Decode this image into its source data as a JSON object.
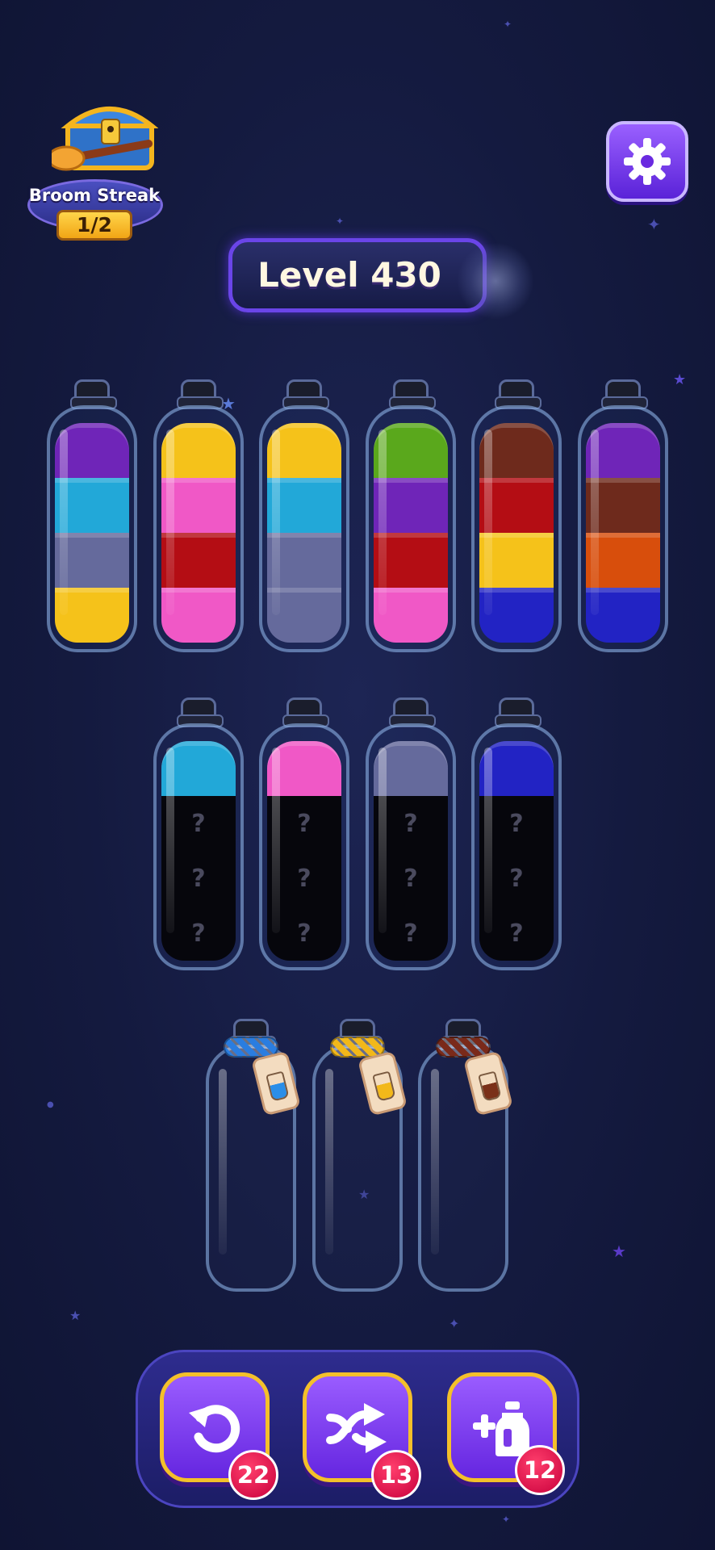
{
  "streak": {
    "title": "Broom Streak",
    "count": "1/2"
  },
  "level": {
    "label": "Level 430"
  },
  "colors": {
    "purple": "#6f25b8",
    "cyan": "#22a8d8",
    "slate": "#656a9c",
    "yellow": "#f5c21a",
    "pink": "#f058c6",
    "red": "#b40d14",
    "green": "#5aa81c",
    "brown": "#6e2a1c",
    "blue": "#2223c4",
    "orange": "#d84e0c",
    "hidden": "#06060c",
    "accent": "#6a45e8",
    "badge": "#d6104a"
  },
  "bottles": {
    "row1": [
      {
        "layers": [
          "yellow",
          "slate",
          "cyan",
          "purple"
        ]
      },
      {
        "layers": [
          "pink",
          "red",
          "pink",
          "yellow"
        ]
      },
      {
        "layers": [
          "slate",
          "slate",
          "cyan",
          "yellow"
        ]
      },
      {
        "layers": [
          "pink",
          "red",
          "purple",
          "green"
        ]
      },
      {
        "layers": [
          "blue",
          "yellow",
          "red",
          "brown"
        ]
      },
      {
        "layers": [
          "blue",
          "orange",
          "brown",
          "purple"
        ]
      }
    ],
    "row2": [
      {
        "top": "cyan",
        "unknown": [
          "?",
          "?",
          "?"
        ]
      },
      {
        "top": "pink",
        "unknown": [
          "?",
          "?",
          "?"
        ]
      },
      {
        "top": "slate",
        "unknown": [
          "?",
          "?",
          "?"
        ]
      },
      {
        "top": "blue",
        "unknown": [
          "?",
          "?",
          "?"
        ]
      }
    ],
    "locked": [
      {
        "rope_color": "#2a7de0",
        "vial_color": "#2a8ee8"
      },
      {
        "rope_color": "#f2b81a",
        "vial_color": "#f2b81a"
      },
      {
        "rope_color": "#7a2a1a",
        "vial_color": "#7a3018"
      }
    ]
  },
  "toolbar": {
    "undo": {
      "icon": "undo-icon",
      "count": "22"
    },
    "shuffle": {
      "icon": "shuffle-icon",
      "count": "13"
    },
    "add_bottle": {
      "icon": "add-bottle-icon",
      "count": "12"
    }
  }
}
